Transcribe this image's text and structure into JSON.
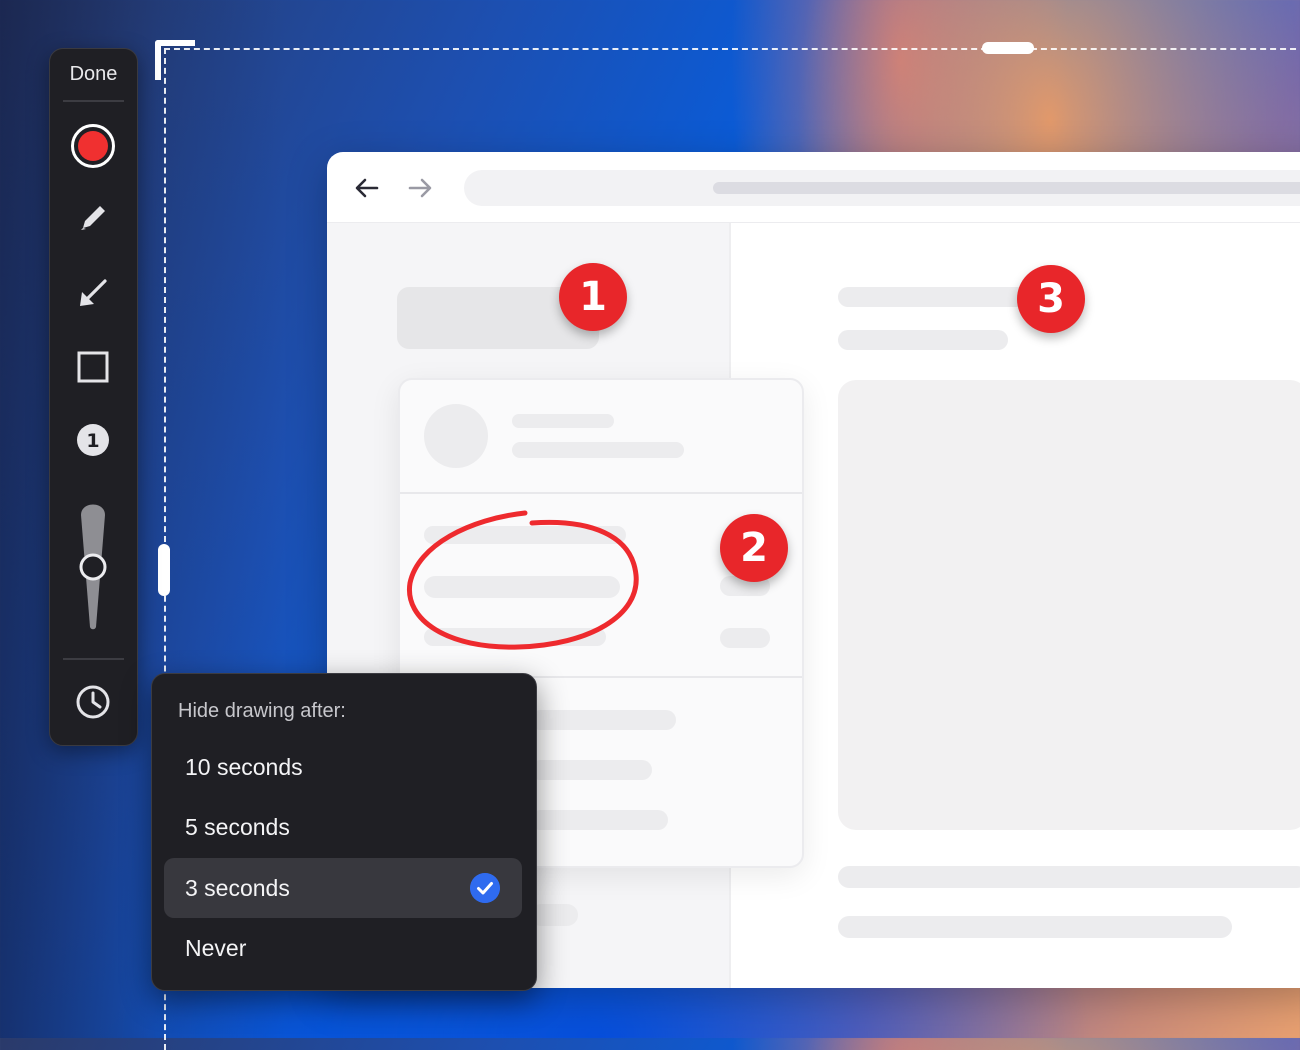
{
  "palette": {
    "done_label": "Done",
    "tools": [
      {
        "icon": "record-dot-icon",
        "color": "#f03030"
      },
      {
        "icon": "pencil-icon"
      },
      {
        "icon": "arrow-icon"
      },
      {
        "icon": "rectangle-icon"
      },
      {
        "icon": "number-badge-icon",
        "number": "1"
      },
      {
        "icon": "stroke-size-slider"
      },
      {
        "icon": "clock-icon"
      }
    ]
  },
  "popover": {
    "title": "Hide drawing after:",
    "options": [
      {
        "label": "10 seconds",
        "selected": false
      },
      {
        "label": "5 seconds",
        "selected": false
      },
      {
        "label": "3 seconds",
        "selected": true
      },
      {
        "label": "Never",
        "selected": false
      }
    ]
  },
  "annotations": {
    "badge_1": "1",
    "badge_2": "2",
    "badge_3": "3",
    "badge_color": "#e8262a"
  },
  "browser": {
    "back_icon": "arrow-left-icon",
    "forward_icon": "arrow-right-icon"
  }
}
